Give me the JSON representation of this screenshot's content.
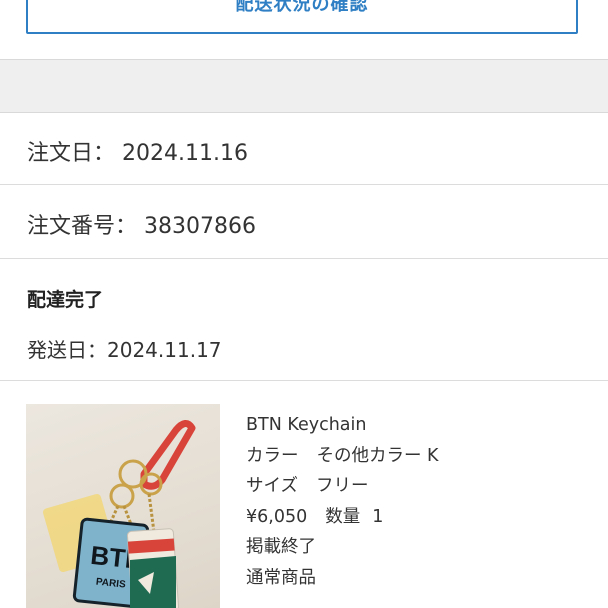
{
  "tracking_button": {
    "label": "配送状況の確認"
  },
  "order": {
    "date_label": "注文日：",
    "date_value": "2024.11.16",
    "number_label": "注文番号：",
    "number_value": "38307866"
  },
  "delivery": {
    "status": "配達完了",
    "ship_date_label": "発送日：",
    "ship_date_value": "2024.11.17"
  },
  "product": {
    "name": "BTN Keychain",
    "color_label": "カラー",
    "color_value": "その他カラー K",
    "size_label": "サイズ",
    "size_value": "フリー",
    "price": "¥6,050",
    "quantity_label": "数量",
    "quantity_value": "1",
    "listing_status": "掲載終了",
    "product_type": "通常商品",
    "image_tag_text": "BTN",
    "image_tag_city": "PARIS",
    "colors": {
      "carabiner": "#d9443a",
      "tag_blue": "#7fb3cc",
      "tag_green": "#1f6b52",
      "tag_yellow": "#f1d77a"
    }
  },
  "colors": {
    "accent": "#2f7fc4",
    "band": "#efeff0",
    "divider": "#dcdcdc"
  }
}
